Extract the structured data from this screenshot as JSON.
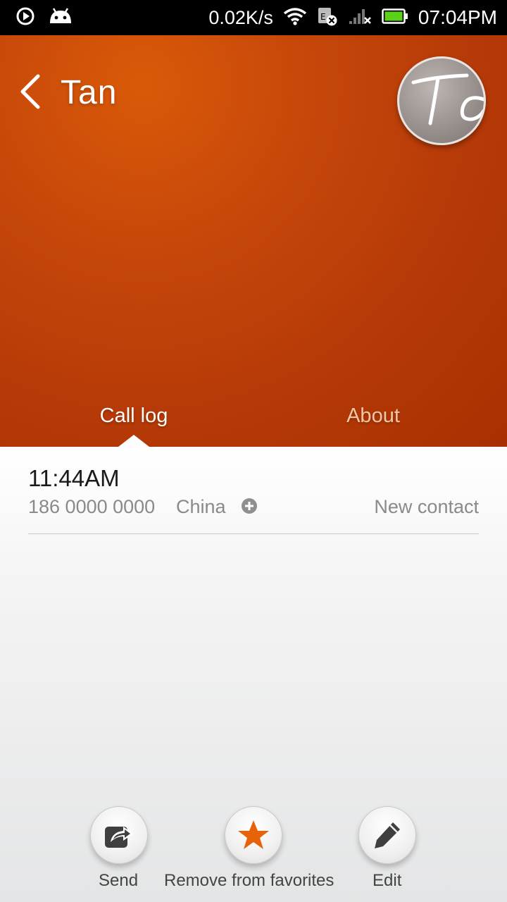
{
  "status_bar": {
    "net_speed": "0.02K/s",
    "time": "07:04PM",
    "icons": [
      "play-icon",
      "android-icon",
      "wifi-icon",
      "sim-error-icon",
      "signal-icon",
      "battery-icon"
    ],
    "battery_color": "#5cd11a"
  },
  "header": {
    "contact_name": "Tan",
    "avatar_initials": "Ta",
    "accent": "#c8480a"
  },
  "tabs": [
    {
      "label": "Call log",
      "active": true
    },
    {
      "label": "About",
      "active": false
    }
  ],
  "call_log": {
    "time": "11:44AM",
    "number": "186 0000 0000",
    "location": "China",
    "new_contact_label": "New contact"
  },
  "actions": {
    "send": "Send",
    "favorite": "Remove from favorites",
    "edit": "Edit",
    "favorite_color": "#e8620a"
  }
}
